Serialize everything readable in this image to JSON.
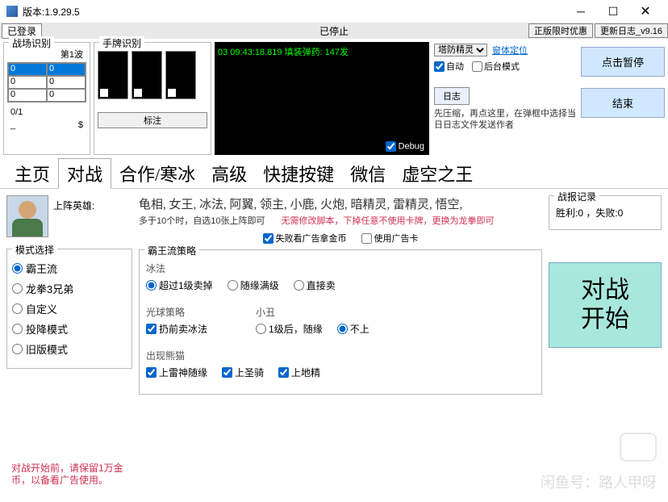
{
  "window": {
    "title": "版本:1.9.29.5"
  },
  "statusbar": {
    "login": "已登录",
    "center": "已停止",
    "btn_limit": "正版限时优惠",
    "btn_update": "更新日志_v9.16"
  },
  "battlefield": {
    "title": "战场识别",
    "wave": "第1波",
    "rows": [
      [
        "0",
        "0"
      ],
      [
        "0",
        "0"
      ],
      [
        "0",
        "0"
      ]
    ],
    "progress": "0/1",
    "foot_l": "_",
    "foot_r": "$"
  },
  "handrec": {
    "title": "手牌识别",
    "mark": "标注"
  },
  "console": {
    "line": "03 09:43:18.819 填装弹药: 147发",
    "debug": "Debug"
  },
  "rightpanel": {
    "select": "塔防精灵",
    "locate": "窗体定位",
    "chk_auto": "自动",
    "chk_bg": "后台模式",
    "log": "日志",
    "hint": "先压缩，再点这里，在弹框中选择当日日志文件发送作者"
  },
  "bigbtn": {
    "pause": "点击暂停",
    "end": "结束"
  },
  "tabs": [
    "主页",
    "对战",
    "合作/寒冰",
    "高级",
    "快捷按键",
    "微信",
    "虚空之王"
  ],
  "heroes": {
    "label": "上阵英雄:",
    "list": "龟相, 女王, 冰法, 阿翼, 领主, 小鹿, 火炮, 暗精灵, 雷精灵, 悟空,",
    "note1": "多于10个时，自选10张上阵即可",
    "note2": "无需修改脚本，下掉任意不使用卡牌，更换为龙拳即可"
  },
  "modes": {
    "title": "模式选择",
    "items": [
      "霸王流",
      "龙拳3兄弟",
      "自定义",
      "投降模式",
      "旧版模式"
    ]
  },
  "chks": {
    "ad": "失败看广告拿金币",
    "card": "使用广告卡"
  },
  "strategy": {
    "title": "霸王流策略",
    "ice_title": "冰法",
    "ice_opts": [
      "超过1级卖掉",
      "随缘满级",
      "直接卖"
    ],
    "orb_title": "光球策略",
    "orb_opt": "扔前卖冰法",
    "clown_title": "小丑",
    "clown_opts": [
      "1级后，随缘",
      "不上"
    ],
    "panda_title": "出现熊猫",
    "panda_opts": [
      "上雷神随缘",
      "上圣骑",
      "上地精"
    ]
  },
  "warrec": {
    "title": "战报记录",
    "text": "胜利:0 ，失败:0"
  },
  "start": "对战\n开始",
  "warn": "对战开始前，请保留1万金币，以备看广告使用。",
  "watermark": "闲鱼号：路人甲呀"
}
